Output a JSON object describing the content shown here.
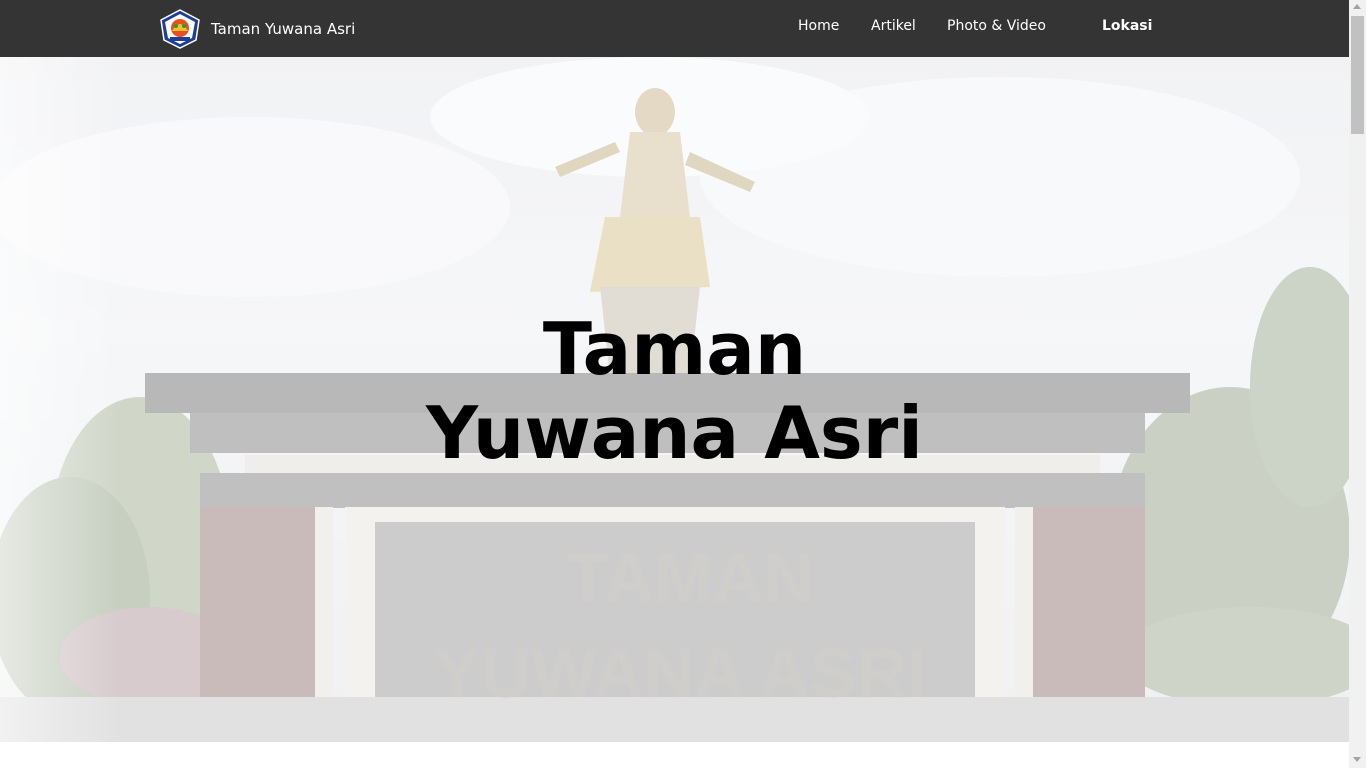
{
  "navbar": {
    "brand_text": "Taman Yuwana Asri",
    "brand_icon": "regional-emblem-icon",
    "links": [
      {
        "label": "Home"
      },
      {
        "label": "Artikel"
      },
      {
        "label": "Photo & Video"
      },
      {
        "label": "Lokasi"
      }
    ]
  },
  "hero": {
    "title_line1": "Taman",
    "title_line2": "Yuwana Asri",
    "sign_line1": "TAMAN",
    "sign_line2": "YUWANA ASRI"
  },
  "colors": {
    "navbar_bg": "#343434",
    "nav_text": "#ffffff",
    "title_text": "#000000"
  }
}
